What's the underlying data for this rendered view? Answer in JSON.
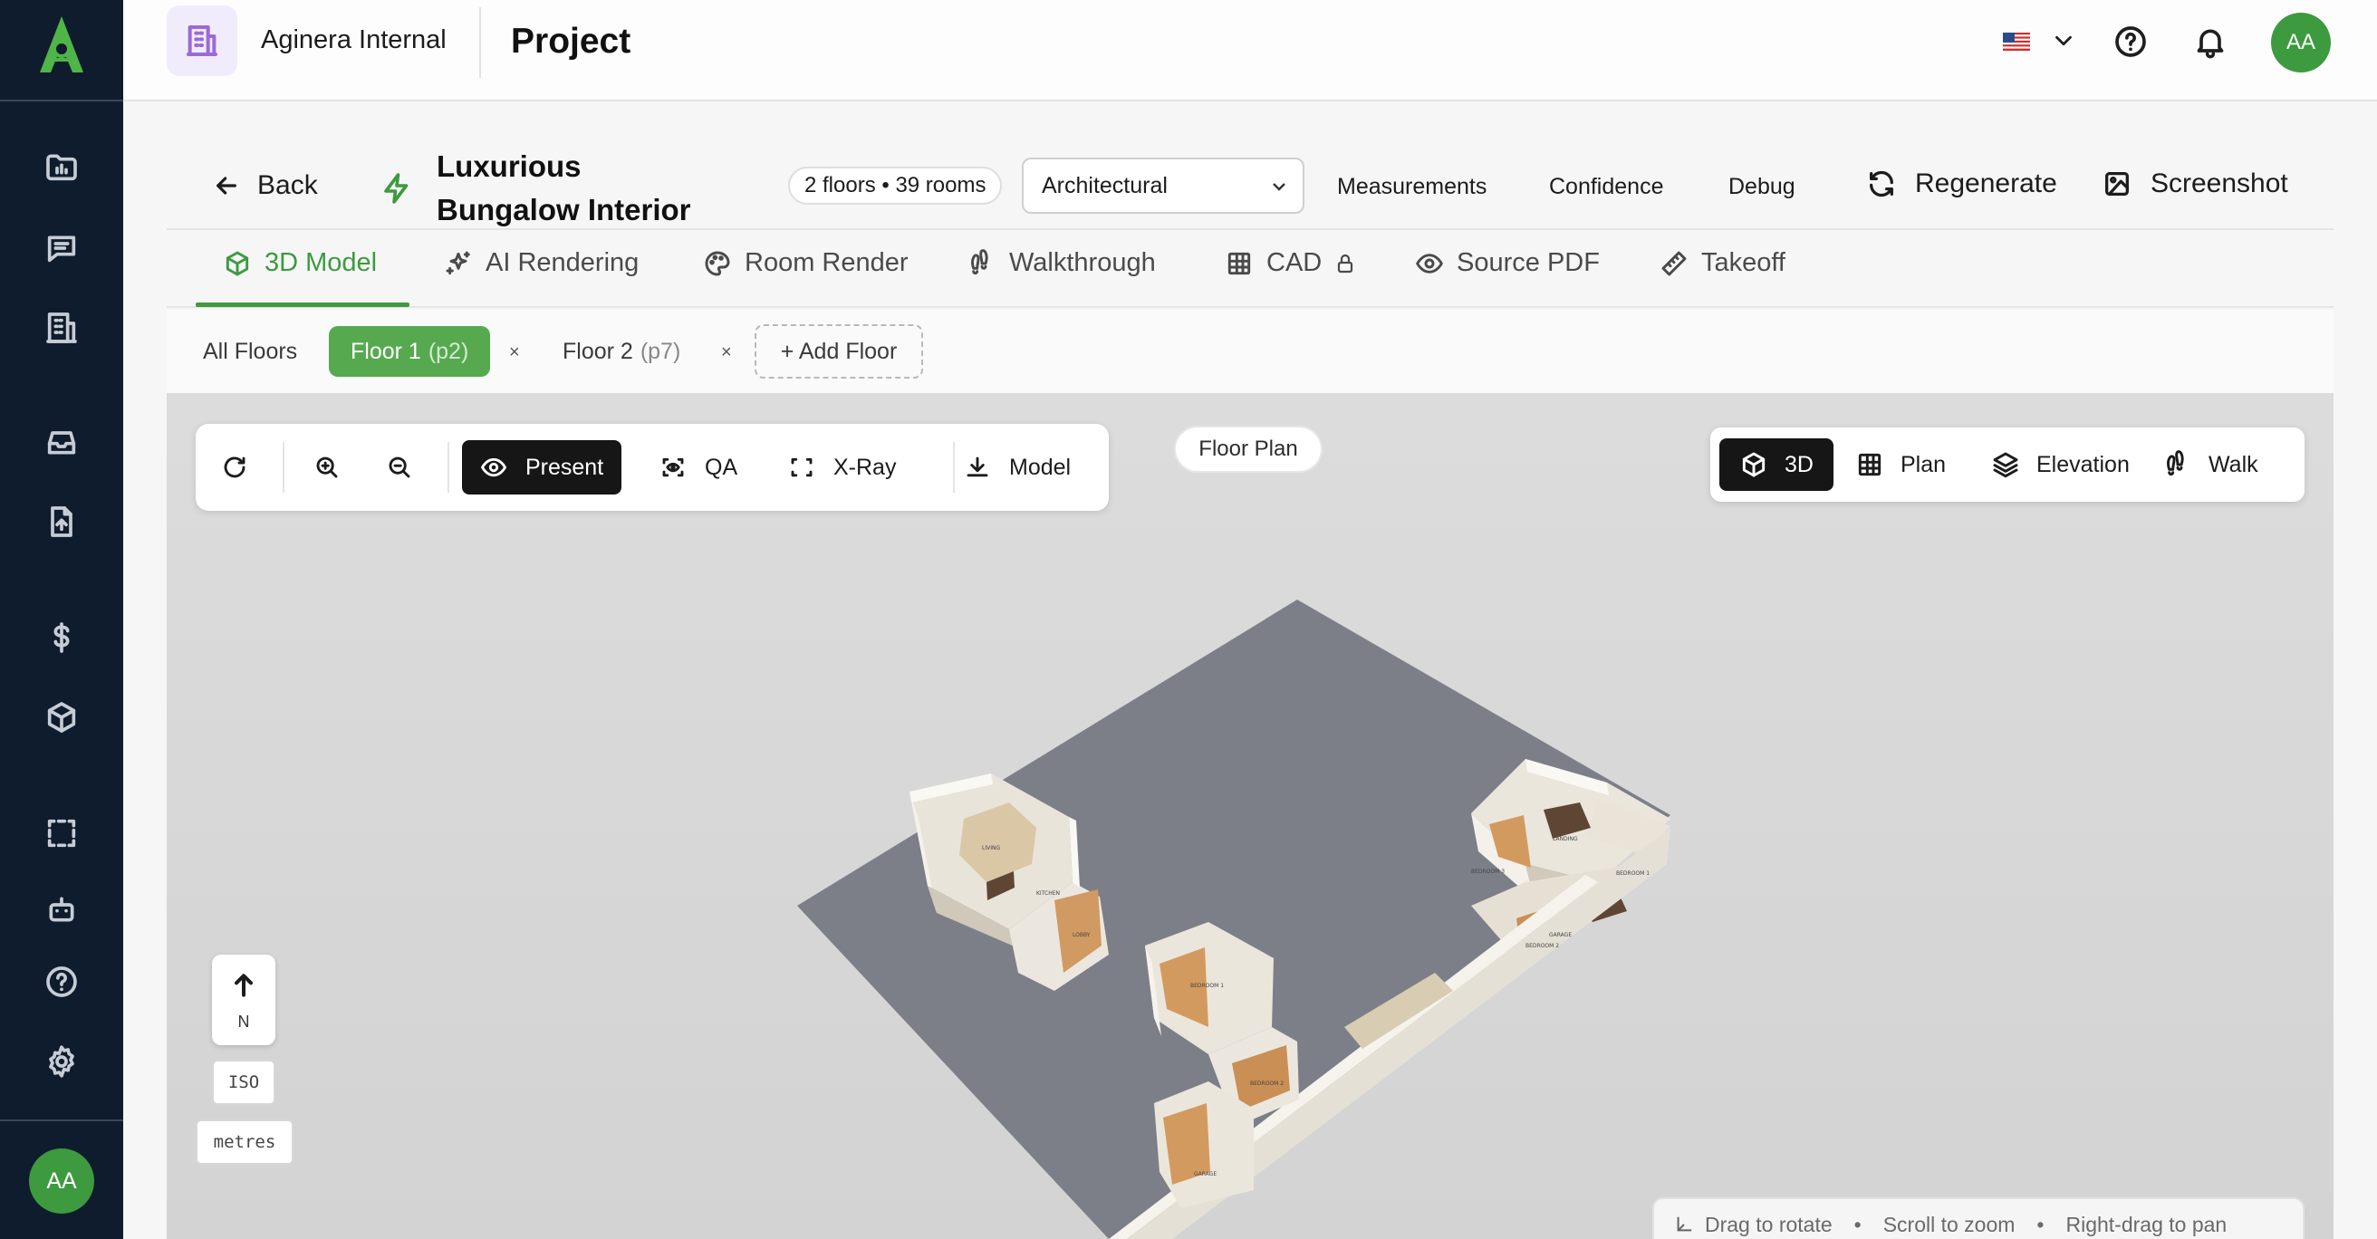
{
  "sidebar": {
    "items": [
      {
        "name": "folder-chart-icon"
      },
      {
        "name": "message-icon"
      },
      {
        "name": "building-icon"
      },
      {
        "name": "inbox-icon"
      },
      {
        "name": "file-upload-icon"
      },
      {
        "name": "dollar-icon"
      },
      {
        "name": "cube-icon"
      },
      {
        "name": "select-dashed-icon"
      },
      {
        "name": "bot-icon"
      },
      {
        "name": "help-icon"
      },
      {
        "name": "settings-icon"
      }
    ],
    "avatar_initials": "AA"
  },
  "header": {
    "org_name": "Aginera Internal",
    "title": "Project",
    "avatar_initials": "AA",
    "language_icon": "us-flag-icon"
  },
  "project": {
    "back_label": "Back",
    "name": "Luxurious Bungalow Interior",
    "counts": "2 floors • 39 rooms",
    "style_select": "Architectural",
    "measurements_label": "Measurements",
    "confidence_label": "Confidence",
    "debug_label": "Debug",
    "regenerate_label": "Regenerate",
    "screenshot_label": "Screenshot"
  },
  "tabs": [
    {
      "label": "3D Model",
      "active": true
    },
    {
      "label": "AI Rendering"
    },
    {
      "label": "Room Render"
    },
    {
      "label": "Walkthrough"
    },
    {
      "label": "CAD",
      "locked": true
    },
    {
      "label": "Source PDF"
    },
    {
      "label": "Takeoff"
    }
  ],
  "floors": {
    "all_label": "All Floors",
    "items": [
      {
        "label": "Floor 1",
        "page": "(p2)",
        "active": true
      },
      {
        "label": "Floor 2",
        "page": "(p7)"
      }
    ],
    "remove_glyph": "×",
    "add_label": "+ Add Floor"
  },
  "toolbar": {
    "present_label": "Present",
    "qa_label": "QA",
    "xray_label": "X-Ray",
    "model_label": "Model"
  },
  "viewer": {
    "floor_plan_label": "Floor Plan",
    "modes": [
      {
        "label": "3D",
        "active": true
      },
      {
        "label": "Plan"
      },
      {
        "label": "Elevation"
      },
      {
        "label": "Walk"
      }
    ],
    "compass_label": "N",
    "projection_label": "ISO",
    "units_label": "metres",
    "hints": [
      "Drag to rotate",
      "Scroll to zoom",
      "Right-drag to pan"
    ],
    "hint_separator": "•",
    "room_labels": [
      "LIVING",
      "KITCHEN",
      "LOBBY",
      "LANDING",
      "BEDROOM 3",
      "BEDROOM 1",
      "GARAGE",
      "BEDROOM 2",
      "BEDROOM 1",
      "BEDROOM 2",
      "GARAGE"
    ]
  },
  "colors": {
    "brand_green": "#3d9a3f",
    "sidebar_bg": "#0f1c2d",
    "viewport_bg": "#dedede",
    "slab": "#7c7f88",
    "wall": "#f1eee8",
    "floor_wood": "#c8955e"
  }
}
